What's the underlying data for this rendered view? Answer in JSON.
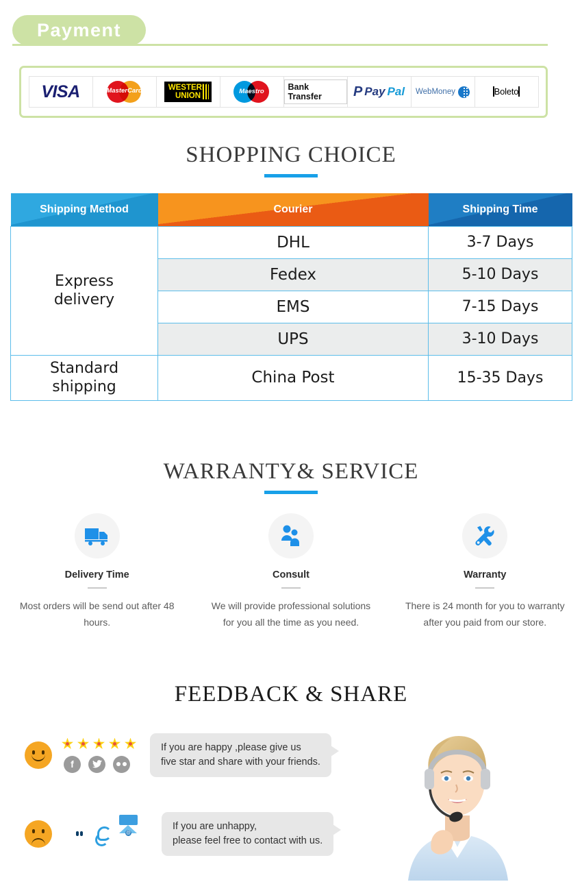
{
  "payment": {
    "heading": "Payment",
    "methods": [
      {
        "name": "VISA",
        "icon": "visa-logo"
      },
      {
        "name": "MasterCard",
        "icon": "mastercard-logo"
      },
      {
        "name": "WESTERN UNION",
        "line1": "WESTERN",
        "line2": "UNION",
        "icon": "western-union-logo"
      },
      {
        "name": "Maestro",
        "icon": "maestro-logo"
      },
      {
        "name": "Bank Transfer",
        "icon": "bank-transfer-logo"
      },
      {
        "name": "PayPal",
        "part1": "Pay",
        "part2": "Pal",
        "icon": "paypal-logo"
      },
      {
        "name": "WebMoney",
        "icon": "webmoney-logo"
      },
      {
        "name": "Boleto",
        "icon": "boleto-logo"
      }
    ]
  },
  "shopping_choice": {
    "title": "SHOPPING CHOICE",
    "columns": [
      "Shipping Method",
      "Courier",
      "Shipping Time"
    ],
    "rows": [
      {
        "method": "Express delivery",
        "method_line1": "Express",
        "method_line2": "delivery",
        "couriers": [
          {
            "courier": "DHL",
            "time": "3-7  Days"
          },
          {
            "courier": "Fedex",
            "time": "5-10 Days"
          },
          {
            "courier": "EMS",
            "time": "7-15 Days"
          },
          {
            "courier": "UPS",
            "time": "3-10 Days"
          }
        ]
      },
      {
        "method": "Standard shipping",
        "method_line1": "Standard",
        "method_line2": "shipping",
        "couriers": [
          {
            "courier": "China Post",
            "time": "15-35 Days"
          }
        ]
      }
    ]
  },
  "warranty": {
    "title": "WARRANTY& SERVICE",
    "features": [
      {
        "icon": "truck-icon",
        "name": "Delivery Time",
        "desc": "Most orders will be send out after 48 hours."
      },
      {
        "icon": "consult-people-icon",
        "name": "Consult",
        "desc": "We will provide professional solutions for you all the time as you need."
      },
      {
        "icon": "tools-icon",
        "name": "Warranty",
        "desc": "There is  24  month for you to warranty after you paid from our store."
      }
    ]
  },
  "feedback": {
    "title": "FEEDBACK & SHARE",
    "happy": {
      "face": "smiley-happy-icon",
      "stars": 5,
      "socials": [
        "facebook-icon",
        "twitter-icon",
        "flickr-icon"
      ],
      "message_line1": "If you are happy ,please give us",
      "message_line2": "five star and share with your friends."
    },
    "unhappy": {
      "face": "smiley-sad-icon",
      "contacts": [
        "msn-messenger-icon",
        "trademanager-icon",
        "email-icon"
      ],
      "message_line1": "If you are unhappy,",
      "message_line2": "please feel free to contact with us."
    },
    "agent_photo": "customer-service-agent-photo"
  },
  "colors": {
    "green": "#cde2a5",
    "accent_blue": "#18a0e8",
    "header_light_blue": "#2fa8e0",
    "header_orange": "#f7941e",
    "header_dark_blue": "#1f7ec4",
    "table_border": "#5bbdea",
    "row_alt": "#ebeded",
    "icon_blue": "#1e90e8",
    "star_yellow": "#fcd116",
    "face_orange": "#f5a623",
    "bubble_gray": "#e7e7e7"
  }
}
